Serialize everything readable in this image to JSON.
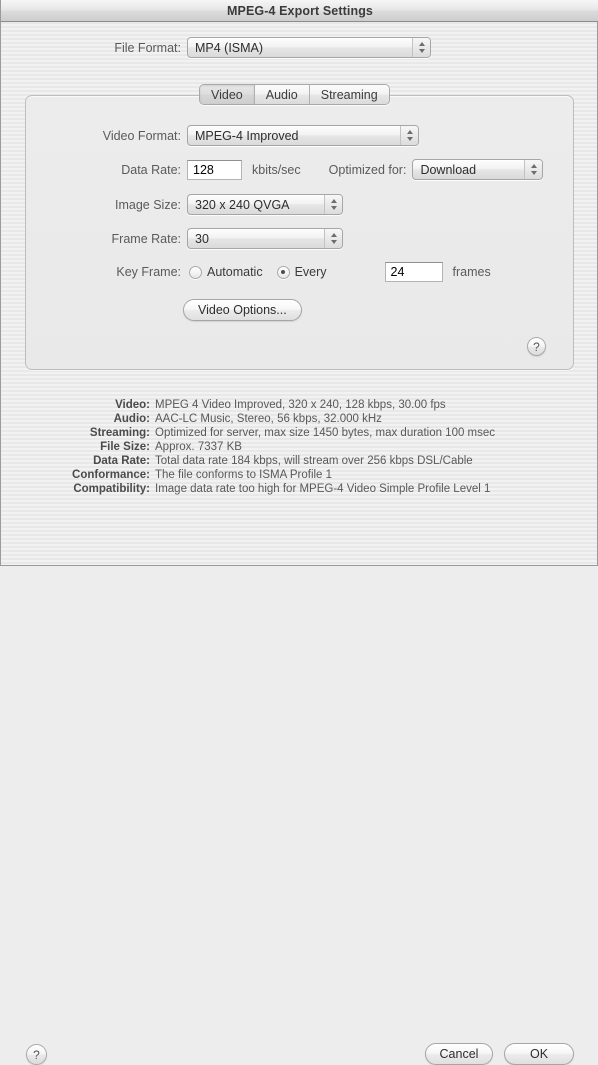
{
  "window": {
    "title": "MPEG-4 Export Settings"
  },
  "file_format": {
    "label": "File Format:",
    "value": "MP4 (ISMA)"
  },
  "tabs": [
    {
      "label": "Video",
      "selected": true
    },
    {
      "label": "Audio",
      "selected": false
    },
    {
      "label": "Streaming",
      "selected": false
    }
  ],
  "video_panel": {
    "video_format": {
      "label": "Video Format:",
      "value": "MPEG-4 Improved"
    },
    "data_rate": {
      "label": "Data Rate:",
      "value": "128",
      "units": "kbits/sec"
    },
    "optimized_for": {
      "label": "Optimized for:",
      "value": "Download"
    },
    "image_size": {
      "label": "Image Size:",
      "value": "320 x 240 QVGA"
    },
    "frame_rate": {
      "label": "Frame Rate:",
      "value": "30"
    },
    "key_frame": {
      "label": "Key Frame:",
      "option_automatic": "Automatic",
      "option_every": "Every",
      "selected": "every",
      "value": "24",
      "units": "frames"
    },
    "video_options_button": "Video Options...",
    "help_button": "?"
  },
  "summary": [
    {
      "key": "Video:",
      "value": "MPEG 4 Video Improved, 320 x 240, 128 kbps, 30.00 fps"
    },
    {
      "key": "Audio:",
      "value": "AAC-LC Music, Stereo, 56 kbps, 32.000 kHz"
    },
    {
      "key": "Streaming:",
      "value": "Optimized for server, max size 1450 bytes, max duration 100 msec"
    },
    {
      "key": "File Size:",
      "value": "Approx. 7337 KB"
    },
    {
      "key": "Data Rate:",
      "value": "Total data rate 184 kbps, will stream over 256 kbps DSL/Cable"
    },
    {
      "key": "Conformance:",
      "value": "The file conforms to ISMA Profile 1"
    },
    {
      "key": "Compatibility:",
      "value": "Image data rate too high for MPEG-4 Video Simple Profile Level 1"
    }
  ],
  "footer": {
    "help_button": "?",
    "cancel_button": "Cancel",
    "ok_button": "OK"
  },
  "colors": {
    "window_bg": "#ededed",
    "panel_bg": "#eaeaea",
    "label_text": "#5a5a5a",
    "value_text": "#2d2d2d",
    "border": "#bdbdbd"
  }
}
